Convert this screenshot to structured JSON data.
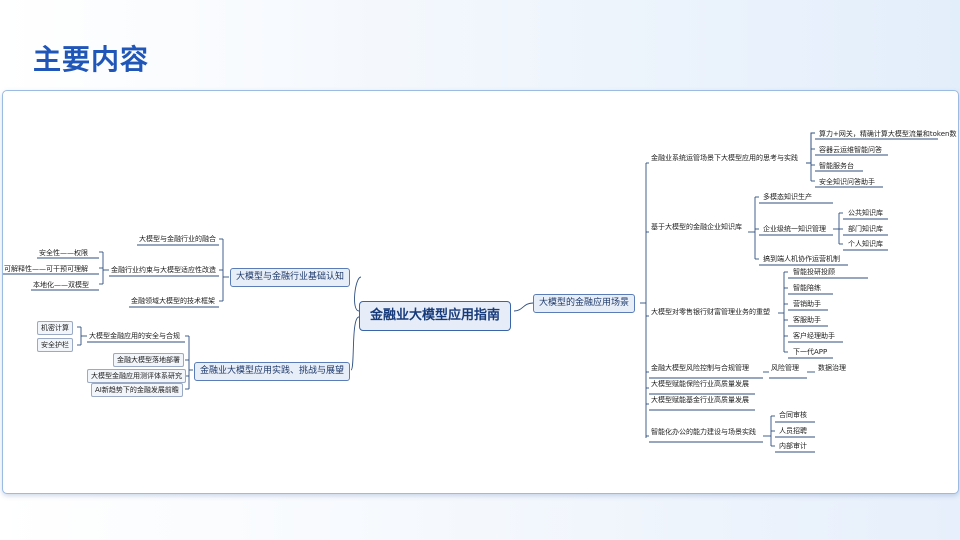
{
  "slide": {
    "title": "主要内容"
  },
  "mindmap": {
    "center": "金融业大模型应用指南",
    "left": {
      "basic": {
        "label": "大模型与金融行业基础认知",
        "children": [
          "大模型与金融行业的融合",
          "金融行业约束与大模型适应性改造",
          "金融领域大模型的技术框架"
        ],
        "sub": [
          "安全性——权限",
          "可解释性——可干预可理解",
          "本地化——双模型"
        ]
      },
      "practice": {
        "label": "金融业大模型应用实践、挑战与展望",
        "children": [
          "大模型金融应用的安全与合规",
          "金融大模型落地部署",
          "大模型金融应用测评体系研究",
          "AI新趋势下的金融发展前瞻"
        ],
        "sub": [
          "机密计算",
          "安全护栏"
        ]
      }
    },
    "right": {
      "label": "大模型的金融应用场景",
      "ops": {
        "label": "金融业系统运管场景下大模型应用的思考与实践",
        "children": [
          "算力+网关，精确计算大模型流量和token数",
          "容器云运维智能问答",
          "智能服务台",
          "安全知识问答助手"
        ]
      },
      "knowledge": {
        "label": "基于大模型的金融企业知识库",
        "children": [
          "多模态知识生产",
          "企业级统一知识管理",
          "搞到端人机协作运营机制"
        ],
        "sub": [
          "公共知识库",
          "部门知识库",
          "个人知识库"
        ]
      },
      "wealth": {
        "label": "大模型对零售银行财富管理业务的重塑",
        "children": [
          "智能投研投顾",
          "智能陪练",
          "营销助手",
          "客服助手",
          "客户经理助手",
          "下一代APP"
        ]
      },
      "risk": {
        "label": "金融大模型风险控制与合规管理",
        "child": "风险管理",
        "grandchild": "数据治理"
      },
      "insurance": {
        "label": "大模型赋能保险行业高质量发展"
      },
      "fund": {
        "label": "大模型赋能基金行业高质量发展"
      },
      "office": {
        "label": "智能化办公的能力建设与场景实践",
        "children": [
          "合同审核",
          "人员招聘",
          "内部审计"
        ]
      }
    }
  }
}
